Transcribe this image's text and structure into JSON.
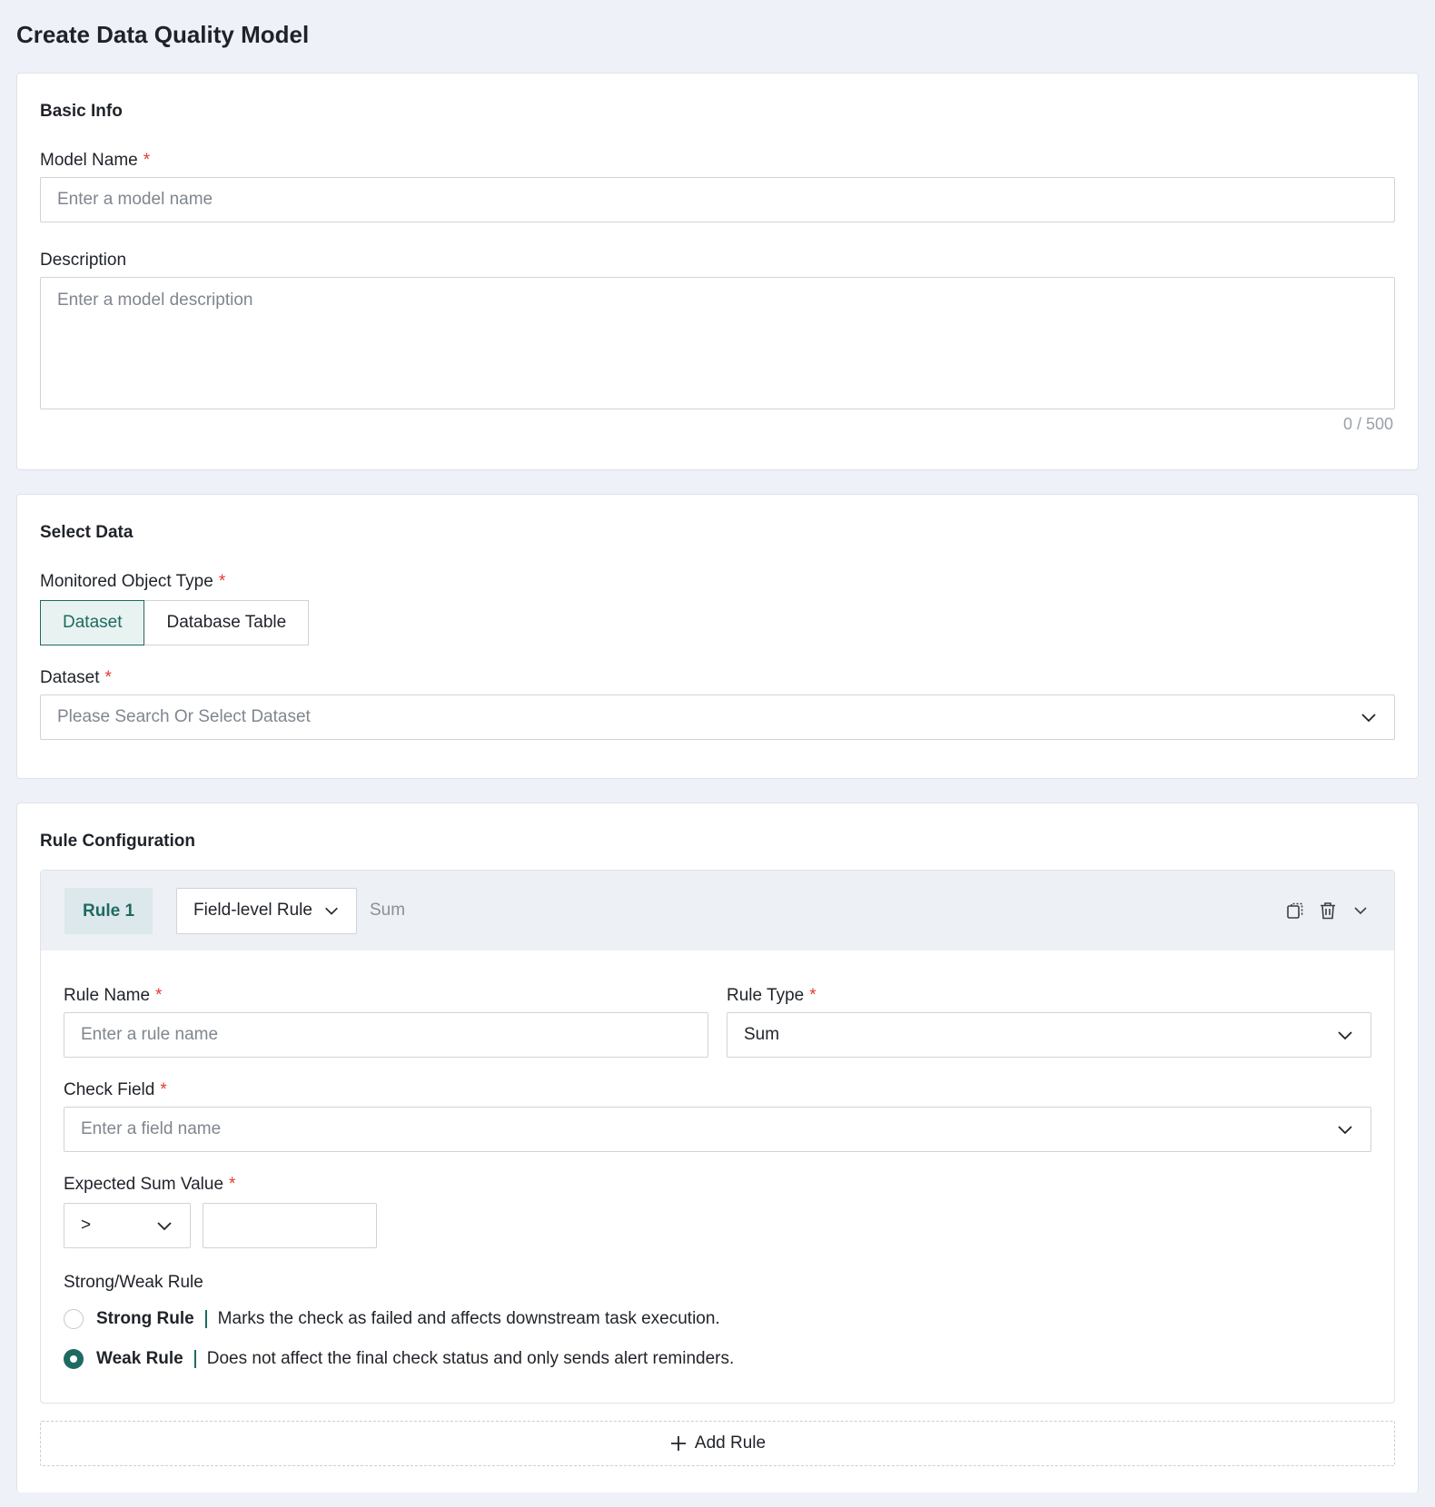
{
  "page": {
    "title": "Create Data Quality Model"
  },
  "basic_info": {
    "section_title": "Basic Info",
    "model_name": {
      "label": "Model Name",
      "required_mark": "*",
      "placeholder": "Enter a model name"
    },
    "description": {
      "label": "Description",
      "placeholder": "Enter a model description",
      "counter": "0 / 500"
    }
  },
  "select_data": {
    "section_title": "Select Data",
    "object_type": {
      "label": "Monitored Object Type",
      "required_mark": "*",
      "options": [
        "Dataset",
        "Database Table"
      ],
      "selected": "Dataset"
    },
    "dataset": {
      "label": "Dataset",
      "required_mark": "*",
      "placeholder": "Please Search Or Select Dataset"
    }
  },
  "rule_config": {
    "section_title": "Rule Configuration",
    "rule": {
      "badge": "Rule 1",
      "level": "Field-level Rule",
      "summary": "Sum",
      "icons": [
        "copy-icon",
        "trash-icon",
        "chevron-down-icon"
      ],
      "rule_name": {
        "label": "Rule Name",
        "required_mark": "*",
        "placeholder": "Enter a rule name"
      },
      "rule_type": {
        "label": "Rule Type",
        "required_mark": "*",
        "value": "Sum"
      },
      "check_field": {
        "label": "Check Field",
        "required_mark": "*",
        "placeholder": "Enter a field name"
      },
      "expected_sum": {
        "label": "Expected Sum Value",
        "required_mark": "*",
        "operator": ">",
        "value": ""
      },
      "strength": {
        "label": "Strong/Weak Rule",
        "options": [
          {
            "name": "Strong Rule",
            "desc": "Marks the check as failed and affects downstream task execution.",
            "selected": false
          },
          {
            "name": "Weak Rule",
            "desc": "Does not affect the final check status and only sends alert reminders.",
            "selected": true
          }
        ]
      }
    },
    "add_rule_label": "Add Rule"
  },
  "colors": {
    "accent": "#1e6a62",
    "required": "#e03c31",
    "page_bg": "#eef1f7"
  }
}
